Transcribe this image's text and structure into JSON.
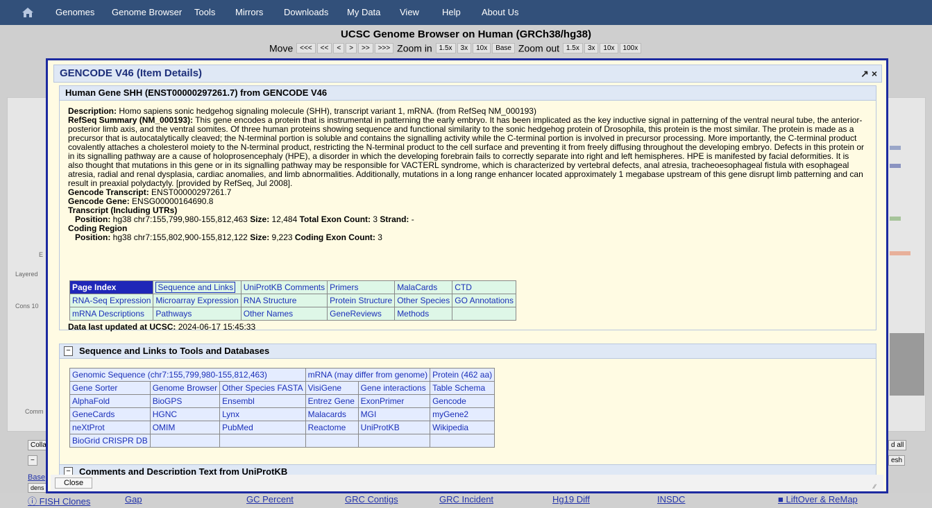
{
  "topnav": {
    "items": [
      "Genomes",
      "Genome Browser",
      "Tools",
      "Mirrors",
      "Downloads",
      "My Data",
      "View",
      "Help",
      "About Us"
    ]
  },
  "browser": {
    "title": "UCSC Genome Browser on Human (GRCh38/hg38)",
    "move_label": "Move",
    "move_buttons": [
      "<<<",
      "<<",
      "<",
      ">",
      ">>",
      ">>>"
    ],
    "zoom_in_label": "Zoom in",
    "zoom_in_buttons": [
      "1.5x",
      "3x",
      "10x",
      "Base"
    ],
    "zoom_out_label": "Zoom out",
    "zoom_out_buttons": [
      "1.5x",
      "3x",
      "10x",
      "100x"
    ],
    "side_labels": [
      "E",
      "Layered",
      "Cons 10",
      "Comm"
    ],
    "left_controls": [
      "Colla",
      "Base",
      "dens"
    ],
    "right_controls": [
      "d all",
      "esh"
    ],
    "bottom_links": [
      "FISH Clones",
      "Gap",
      "GC Percent",
      "GRC Contigs",
      "GRC Incident",
      "Hg19 Diff",
      "INSDC",
      "LiftOver & ReMap"
    ]
  },
  "modal": {
    "title": "GENCODE V46 (Item Details)",
    "gene_header": "Human Gene SHH (ENST00000297261.7) from GENCODE V46",
    "description_label": "Description:",
    "description": "Homo sapiens sonic hedgehog signaling molecule (SHH), transcript variant 1, mRNA. (from RefSeq NM_000193)",
    "refseq_label": "RefSeq Summary (NM_000193):",
    "refseq_summary": "This gene encodes a protein that is instrumental in patterning the early embryo. It has been implicated as the key inductive signal in patterning of the ventral neural tube, the anterior-posterior limb axis, and the ventral somites. Of three human proteins showing sequence and functional similarity to the sonic hedgehog protein of Drosophila, this protein is the most similar. The protein is made as a precursor that is autocatalytically cleaved; the N-terminal portion is soluble and contains the signalling activity while the C-terminal portion is involved in precursor processing. More importantly, the C-terminal product covalently attaches a cholesterol moiety to the N-terminal product, restricting the N-terminal product to the cell surface and preventing it from freely diffusing throughout the developing embryo. Defects in this protein or in its signalling pathway are a cause of holoprosencephaly (HPE), a disorder in which the developing forebrain fails to correctly separate into right and left hemispheres. HPE is manifested by facial deformities. It is also thought that mutations in this gene or in its signalling pathway may be responsible for VACTERL syndrome, which is characterized by vertebral defects, anal atresia, tracheoesophageal fistula with esophageal atresia, radial and renal dysplasia, cardiac anomalies, and limb abnormalities. Additionally, mutations in a long range enhancer located approximately 1 megabase upstream of this gene disrupt limb patterning and can result in preaxial polydactyly. [provided by RefSeq, Jul 2008].",
    "transcript_label": "Gencode Transcript:",
    "transcript": "ENST00000297261.7",
    "gene_label": "Gencode Gene:",
    "gene": "ENSG00000164690.8",
    "utr_heading": "Transcript (Including UTRs)",
    "utr_position_label": "Position:",
    "utr_position": "hg38 chr7:155,799,980-155,812,463",
    "utr_size_label": "Size:",
    "utr_size": "12,484",
    "utr_exon_label": "Total Exon Count:",
    "utr_exon": "3",
    "strand_label": "Strand:",
    "strand": "-",
    "coding_heading": "Coding Region",
    "coding_position_label": "Position:",
    "coding_position": "hg38 chr7:155,802,900-155,812,122",
    "coding_size_label": "Size:",
    "coding_size": "9,223",
    "coding_exon_label": "Coding Exon Count:",
    "coding_exon": "3",
    "page_index": [
      [
        "Page Index",
        "Sequence and Links",
        "UniProtKB Comments",
        "Primers",
        "MalaCards",
        "CTD"
      ],
      [
        "RNA-Seq Expression",
        "Microarray Expression",
        "RNA Structure",
        "",
        "Protein Structure",
        "Other Species",
        "GO Annotations"
      ],
      [
        "mRNA Descriptions",
        "Pathways",
        "Other Names",
        "",
        "GeneReviews",
        "Methods",
        ""
      ]
    ],
    "updated_label": "Data last updated at UCSC:",
    "updated": "2024-06-17 15:45:33",
    "section_links_title": "Sequence and Links to Tools and Databases",
    "links_row1": [
      "Genomic Sequence (chr7:155,799,980-155,812,463)",
      "mRNA (may differ from genome)",
      "Protein (462 aa)"
    ],
    "links_rows": [
      [
        "Gene Sorter",
        "Genome Browser",
        "Other Species FASTA",
        "VisiGene",
        "Gene interactions",
        "Table Schema"
      ],
      [
        "AlphaFold",
        "BioGPS",
        "Ensembl",
        "Entrez Gene",
        "ExonPrimer",
        "Gencode"
      ],
      [
        "GeneCards",
        "HGNC",
        "Lynx",
        "Malacards",
        "MGI",
        "myGene2"
      ],
      [
        "neXtProt",
        "OMIM",
        "PubMed",
        "Reactome",
        "UniProtKB",
        "Wikipedia"
      ],
      [
        "BioGrid CRISPR DB",
        "",
        "",
        "",
        "",
        ""
      ]
    ],
    "section_comments_title": "Comments and Description Text from UniProtKB",
    "close_label": "Close"
  }
}
